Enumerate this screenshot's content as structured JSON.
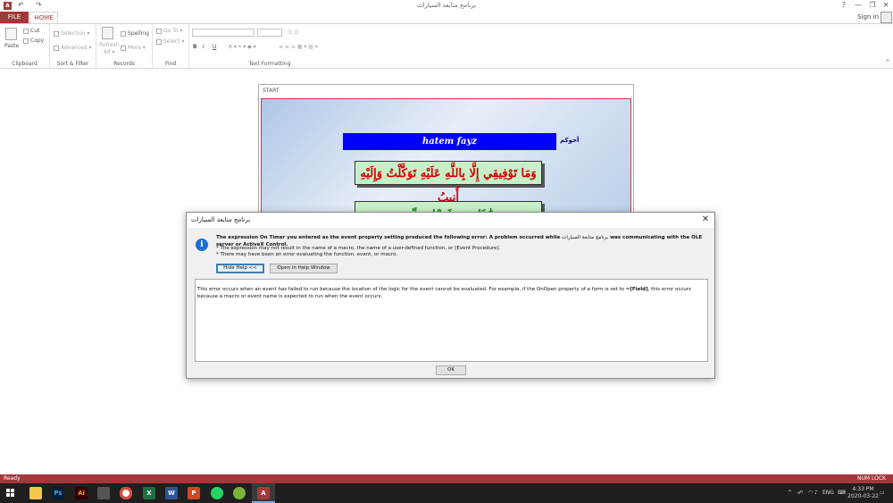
{
  "window": {
    "title": "برنامج متابعة السيارات",
    "help_label": "?",
    "minimize_label": "—",
    "restore_label": "❐",
    "close_label": "✕",
    "undo_label": "↶",
    "redo_label": "↷",
    "app_icon_label": "A"
  },
  "tabs": {
    "file": "FILE",
    "home": "HOME"
  },
  "account": {
    "sign_in": "Sign in"
  },
  "ribbon": {
    "clipboard": {
      "paste": "Paste",
      "cut": "Cut",
      "copy": "Copy",
      "label": "Clipboard"
    },
    "sort_filter": {
      "selection": "Selection ▾",
      "advanced": "Advanced ▾",
      "label": "Sort & Filter"
    },
    "records": {
      "refresh": "Refresh",
      "refresh2": "All ▾",
      "spelling": "Spelling",
      "more": "More ▾",
      "label": "Records"
    },
    "find": {
      "goto": "Go To ▾",
      "select": "Select ▾",
      "label": "Find"
    },
    "text_formatting": {
      "bold": "B",
      "italic": "I",
      "underline": "U",
      "label": "Text Formatting"
    }
  },
  "form": {
    "title": "START",
    "name_label": "أخوكم",
    "name_value": "hatem fayz",
    "verse_1": "وَمَا تَوْفِيقِي إِلَّا بِاللَّهِ عَلَيْهِ تَوَكَّلْتُ وَإِلَيْهِ أُنِيبُ",
    "verse_2": "هَٰذَا مِن فَضْلِ رَبِّي"
  },
  "dialog": {
    "title": "برنامج متابعة السيارات",
    "close_label": "✕",
    "icon_label": "i",
    "message_start": "The expression On Timer you entered as the event property setting produced the following error: A problem occurred while",
    "message_app": "برنامج متابعة السيارات",
    "message_end": "was communicating with the OLE server or ActiveX Control.",
    "bullet_1": "* The expression may not result in the name of a macro, the name of a user-defined function, or [Event Procedure].",
    "bullet_2": "* There may have been an error evaluating the function, event, or macro.",
    "hide_help": "Hide Help <<",
    "open_help": "Open in Help Window",
    "help_text_start": "This error occurs when an event has failed to run because the location of the logic for the event cannot be evaluated. For example, if the OnOpen property of a form is set to =",
    "help_text_bold": "[Field]",
    "help_text_end": ", this error occurs because a macro or event name is expected to run when the event occurs.",
    "ok": "OK"
  },
  "status": {
    "left": "Ready",
    "right": "NUM LOCK"
  },
  "taskbar": {
    "apps": [
      "Ps",
      "Ai",
      "X",
      "W",
      "P",
      "A"
    ],
    "language": "ENG",
    "time": "4:33 PM",
    "date": "2020-03-22"
  }
}
